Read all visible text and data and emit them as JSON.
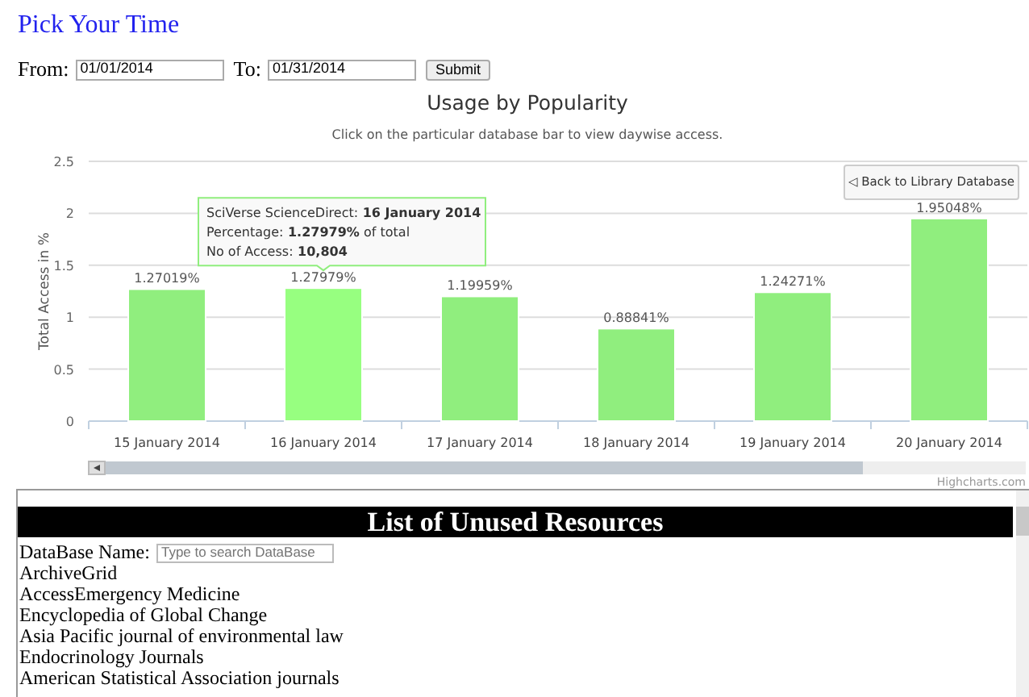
{
  "page_title": "Pick Your Time",
  "date_form": {
    "from_label": "From:",
    "from_value": "01/01/2014",
    "to_label": "To:",
    "to_value": "01/31/2014",
    "submit": "Submit"
  },
  "chart": {
    "back_button": "◁ Back to Library Database",
    "credit": "Highcharts.com",
    "highlighted": [
      false,
      true,
      false,
      false,
      false,
      false
    ],
    "tooltip": {
      "source": "SciVerse ScienceDirect:",
      "category": "16 January 2014",
      "percentage_label": "Percentage:",
      "percentage": "1.27979%",
      "percentage_suffix": "of total",
      "access_label": "No of Access:",
      "access": "10,804"
    },
    "chart_data": {
      "type": "bar",
      "title": "Usage by Popularity",
      "subtitle": "Click on the particular database bar to view daywise access.",
      "ylabel": "Total Access in %",
      "categories": [
        "15 January 2014",
        "16 January 2014",
        "17 January 2014",
        "18 January 2014",
        "19 January 2014",
        "20 January 2014"
      ],
      "series": [
        {
          "color": "#90ee7e",
          "values": [
            1.27,
            1.28,
            1.2,
            0.89,
            1.24,
            1.95
          ]
        }
      ],
      "ylim": [
        0,
        2.5
      ],
      "grid": true,
      "yticks": [
        0,
        0.5,
        1,
        1.5,
        2,
        2.5
      ],
      "value_labels": [
        "1.27019%",
        "1.27979%",
        "1.19959%",
        "0.88841%",
        "1.24271%",
        "1.95048%"
      ]
    }
  },
  "unused_resources": {
    "title": "List of Unused Resources",
    "search_label": "DataBase Name:",
    "search_placeholder": "Type to search DataBase",
    "items": [
      "ArchiveGrid",
      "AccessEmergency Medicine",
      "Encyclopedia of Global Change",
      "Asia Pacific journal of environmental law",
      "Endocrinology Journals",
      "American Statistical Association journals"
    ]
  }
}
